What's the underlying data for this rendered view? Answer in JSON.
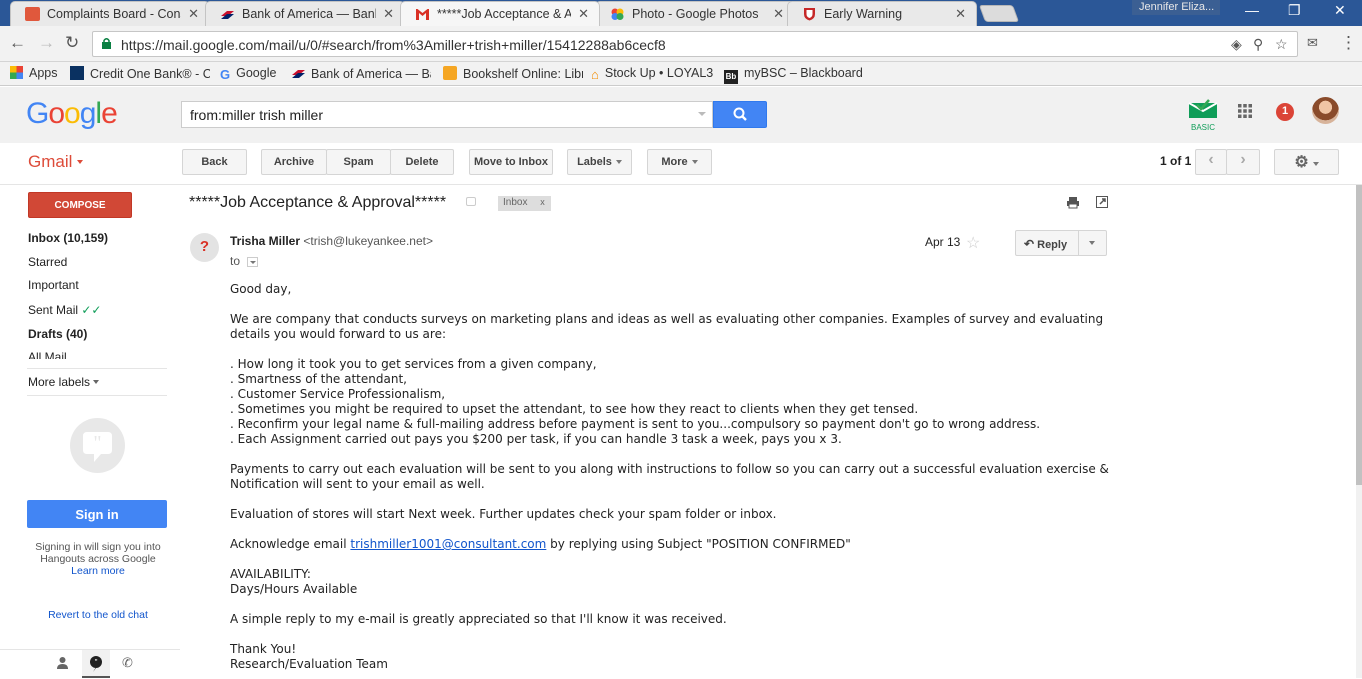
{
  "browser": {
    "tabs": [
      {
        "title": "Complaints Board - Cons",
        "icon": "complaints-board-icon"
      },
      {
        "title": "Bank of America — Bank",
        "icon": "bank-of-america-icon"
      },
      {
        "title": "*****Job Acceptance & A",
        "icon": "gmail-icon",
        "active": true
      },
      {
        "title": "Photo - Google Photos",
        "icon": "google-photos-icon"
      },
      {
        "title": "Early Warning",
        "icon": "early-warning-icon"
      }
    ],
    "profile_name": "Jennifer Eliza...",
    "url": "https://mail.google.com/mail/u/0/#search/from%3Amiller+trish+miller/15412288ab6cecf8",
    "bookmarks": [
      "Apps",
      "Credit One Bank® - C",
      "Google",
      "Bank of America — Ba",
      "Bookshelf Online: Libr",
      "Stock Up • LOYAL3",
      "myBSC – Blackboard L"
    ]
  },
  "gmail": {
    "logo": "Google",
    "search_query": "from:miller trish miller",
    "app_name": "Gmail",
    "basic_label": "BASIC",
    "notification_count": "1",
    "toolbar": {
      "back": "Back",
      "archive": "Archive",
      "spam": "Spam",
      "delete": "Delete",
      "move_to_inbox": "Move to Inbox",
      "labels": "Labels",
      "more": "More",
      "pager": "1 of 1"
    },
    "sidebar": {
      "compose": "COMPOSE",
      "items": [
        {
          "label": "Inbox (10,159)",
          "bold": true
        },
        {
          "label": "Starred",
          "bold": false
        },
        {
          "label": "Important",
          "bold": false
        },
        {
          "label": "Sent Mail",
          "bold": false
        },
        {
          "label": "Drafts (40)",
          "bold": true
        },
        {
          "label": "All Mail",
          "bold": false
        }
      ],
      "more_labels": "More labels",
      "sign_in": "Sign in",
      "sign_in_text": "Signing in will sign you into Hangouts across Google",
      "learn_more": "Learn more",
      "revert_chat": "Revert to the old chat"
    },
    "message": {
      "subject": "*****Job Acceptance & Approval*****",
      "label": "Inbox",
      "label_remove": "x",
      "avatar_initial": "?",
      "sender_name": "Trisha Miller",
      "sender_email": "<trish@lukeyankee.net>",
      "to": "to",
      "date": "Apr 13",
      "reply": "Reply",
      "greeting": "Good day,",
      "intro": "We are company that conducts surveys on marketing plans and ideas as well as evaluating other companies. Examples of survey and evaluating details you would forward to us are:",
      "list": [
        ". How long it took you to get services from a given company,",
        ". Smartness of the attendant,",
        ". Customer Service Professionalism,",
        ". Sometimes you might be required to upset the attendant, to see how they react to clients when they get tensed.",
        ". Reconfirm your legal name & full-mailing address before payment is sent to you...compulsory so payment don't go to wrong address.",
        ". Each Assignment carried out pays you $200 per task, if you can handle 3 task a week, pays you x 3."
      ],
      "payments": "Payments to carry out each evaluation will be sent to you along with instructions to follow so you can carry out a successful evaluation exercise & Notification will sent to your email as well.",
      "evaluation": "Evaluation of stores will start Next week. Further updates check your spam folder or inbox.",
      "ack_prefix": "Acknowledge email",
      "ack_email": "trishmiller1001@consultant.com",
      "ack_suffix": "by replying using Subject \"POSITION CONFIRMED\"",
      "availability_title": "AVAILABILITY:",
      "availability_value": "Days/Hours Available",
      "reply_request": "A simple reply to my e-mail is greatly appreciated so that I'll know it was received.",
      "thanks": "Thank You!",
      "signature": "Research/Evaluation Team"
    }
  },
  "colors": {
    "compose_red": "#d14836",
    "search_blue": "#4285f4",
    "gmail_red": "#dd4b39",
    "link_blue": "#1155cc"
  }
}
